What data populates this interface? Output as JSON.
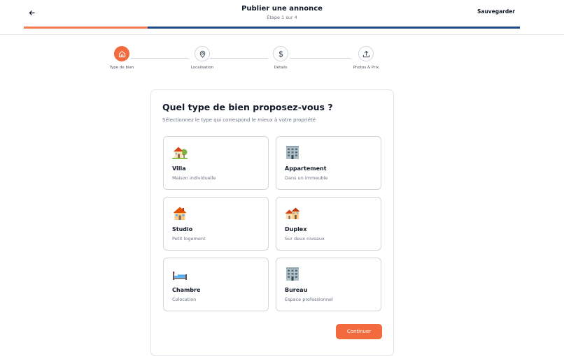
{
  "header": {
    "title": "Publier une annonce",
    "subtitle": "Étape 1 sur 4",
    "save_label": "Sauvegarder",
    "progress_percent": 25
  },
  "steps": [
    {
      "label": "Type de bien",
      "icon": "home-icon",
      "active": true
    },
    {
      "label": "Localisation",
      "icon": "map-pin-icon",
      "active": false
    },
    {
      "label": "Détails",
      "icon": "dollar-icon",
      "active": false
    },
    {
      "label": "Photos & Prix",
      "icon": "upload-icon",
      "active": false
    }
  ],
  "form": {
    "title": "Quel type de bien proposez-vous ?",
    "subtitle": "Sélectionnez le type qui correspond le mieux à votre propriété",
    "options": [
      {
        "name": "Villa",
        "description": "Maison individuelle",
        "icon": "house-garden-icon"
      },
      {
        "name": "Appartement",
        "description": "Dans un immeuble",
        "icon": "building-icon"
      },
      {
        "name": "Studio",
        "description": "Petit logement",
        "icon": "house-icon"
      },
      {
        "name": "Duplex",
        "description": "Sur deux niveaux",
        "icon": "houses-icon"
      },
      {
        "name": "Chambre",
        "description": "Colocation",
        "icon": "bed-icon"
      },
      {
        "name": "Bureau",
        "description": "Espace professionnel",
        "icon": "office-building-icon"
      }
    ],
    "continue_label": "Continuer"
  },
  "colors": {
    "accent": "#f26a3d",
    "progress_track": "#1e4a87",
    "progress_fill": "#f47b51"
  }
}
